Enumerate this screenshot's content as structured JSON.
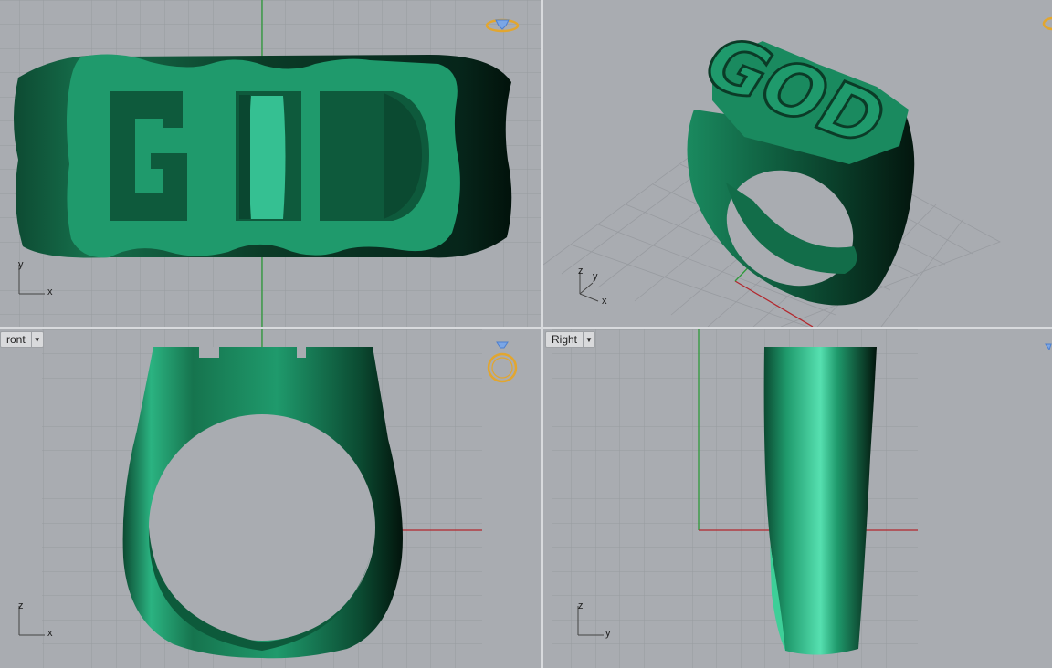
{
  "viewports": {
    "top": {
      "label": "",
      "axis_h": "x",
      "axis_v": "y"
    },
    "perspective": {
      "label": "",
      "axis_h": "x",
      "axis_v": "z",
      "axis_d": "y"
    },
    "front": {
      "label": "ront",
      "axis_h": "x",
      "axis_v": "z"
    },
    "right": {
      "label": "Right",
      "axis_h": "y",
      "axis_v": "z"
    }
  },
  "model_text": "GOD",
  "colors": {
    "viewport_bg": "#a9acb1",
    "grid": "#989ba0",
    "grid_major": "#8b8e93",
    "axis_x": "#b3272d",
    "axis_y": "#2e9a3a",
    "model_green": "#1f9a6c",
    "model_dark": "#0b3b27",
    "icon_gold": "#e2a62f",
    "icon_blue": "#4c7fd0"
  },
  "icons": {
    "top": "ring-gem-icon",
    "perspective": "ring-gem-icon",
    "front": "ring-gem-icon",
    "right": "ring-gem-icon"
  }
}
